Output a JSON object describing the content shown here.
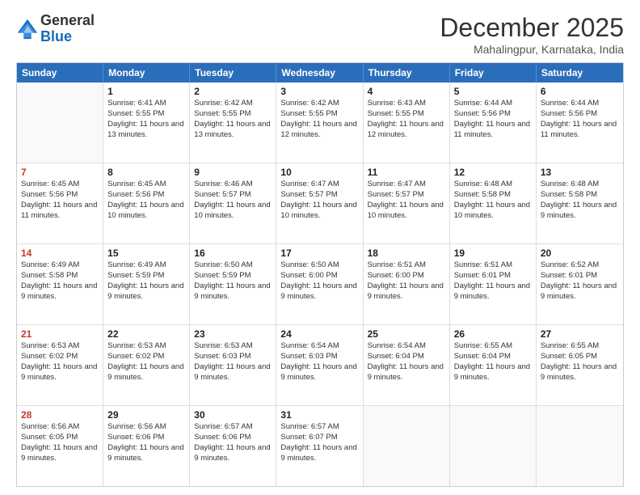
{
  "header": {
    "logo_general": "General",
    "logo_blue": "Blue",
    "month_title": "December 2025",
    "location": "Mahalingpur, Karnataka, India"
  },
  "weekdays": [
    "Sunday",
    "Monday",
    "Tuesday",
    "Wednesday",
    "Thursday",
    "Friday",
    "Saturday"
  ],
  "rows": [
    [
      {
        "day": "",
        "sunrise": "",
        "sunset": "",
        "daylight": "",
        "empty": true
      },
      {
        "day": "1",
        "sunrise": "Sunrise: 6:41 AM",
        "sunset": "Sunset: 5:55 PM",
        "daylight": "Daylight: 11 hours and 13 minutes."
      },
      {
        "day": "2",
        "sunrise": "Sunrise: 6:42 AM",
        "sunset": "Sunset: 5:55 PM",
        "daylight": "Daylight: 11 hours and 13 minutes."
      },
      {
        "day": "3",
        "sunrise": "Sunrise: 6:42 AM",
        "sunset": "Sunset: 5:55 PM",
        "daylight": "Daylight: 11 hours and 12 minutes."
      },
      {
        "day": "4",
        "sunrise": "Sunrise: 6:43 AM",
        "sunset": "Sunset: 5:55 PM",
        "daylight": "Daylight: 11 hours and 12 minutes."
      },
      {
        "day": "5",
        "sunrise": "Sunrise: 6:44 AM",
        "sunset": "Sunset: 5:56 PM",
        "daylight": "Daylight: 11 hours and 11 minutes."
      },
      {
        "day": "6",
        "sunrise": "Sunrise: 6:44 AM",
        "sunset": "Sunset: 5:56 PM",
        "daylight": "Daylight: 11 hours and 11 minutes."
      }
    ],
    [
      {
        "day": "7",
        "sunrise": "Sunrise: 6:45 AM",
        "sunset": "Sunset: 5:56 PM",
        "daylight": "Daylight: 11 hours and 11 minutes."
      },
      {
        "day": "8",
        "sunrise": "Sunrise: 6:45 AM",
        "sunset": "Sunset: 5:56 PM",
        "daylight": "Daylight: 11 hours and 10 minutes."
      },
      {
        "day": "9",
        "sunrise": "Sunrise: 6:46 AM",
        "sunset": "Sunset: 5:57 PM",
        "daylight": "Daylight: 11 hours and 10 minutes."
      },
      {
        "day": "10",
        "sunrise": "Sunrise: 6:47 AM",
        "sunset": "Sunset: 5:57 PM",
        "daylight": "Daylight: 11 hours and 10 minutes."
      },
      {
        "day": "11",
        "sunrise": "Sunrise: 6:47 AM",
        "sunset": "Sunset: 5:57 PM",
        "daylight": "Daylight: 11 hours and 10 minutes."
      },
      {
        "day": "12",
        "sunrise": "Sunrise: 6:48 AM",
        "sunset": "Sunset: 5:58 PM",
        "daylight": "Daylight: 11 hours and 10 minutes."
      },
      {
        "day": "13",
        "sunrise": "Sunrise: 6:48 AM",
        "sunset": "Sunset: 5:58 PM",
        "daylight": "Daylight: 11 hours and 9 minutes."
      }
    ],
    [
      {
        "day": "14",
        "sunrise": "Sunrise: 6:49 AM",
        "sunset": "Sunset: 5:58 PM",
        "daylight": "Daylight: 11 hours and 9 minutes."
      },
      {
        "day": "15",
        "sunrise": "Sunrise: 6:49 AM",
        "sunset": "Sunset: 5:59 PM",
        "daylight": "Daylight: 11 hours and 9 minutes."
      },
      {
        "day": "16",
        "sunrise": "Sunrise: 6:50 AM",
        "sunset": "Sunset: 5:59 PM",
        "daylight": "Daylight: 11 hours and 9 minutes."
      },
      {
        "day": "17",
        "sunrise": "Sunrise: 6:50 AM",
        "sunset": "Sunset: 6:00 PM",
        "daylight": "Daylight: 11 hours and 9 minutes."
      },
      {
        "day": "18",
        "sunrise": "Sunrise: 6:51 AM",
        "sunset": "Sunset: 6:00 PM",
        "daylight": "Daylight: 11 hours and 9 minutes."
      },
      {
        "day": "19",
        "sunrise": "Sunrise: 6:51 AM",
        "sunset": "Sunset: 6:01 PM",
        "daylight": "Daylight: 11 hours and 9 minutes."
      },
      {
        "day": "20",
        "sunrise": "Sunrise: 6:52 AM",
        "sunset": "Sunset: 6:01 PM",
        "daylight": "Daylight: 11 hours and 9 minutes."
      }
    ],
    [
      {
        "day": "21",
        "sunrise": "Sunrise: 6:53 AM",
        "sunset": "Sunset: 6:02 PM",
        "daylight": "Daylight: 11 hours and 9 minutes."
      },
      {
        "day": "22",
        "sunrise": "Sunrise: 6:53 AM",
        "sunset": "Sunset: 6:02 PM",
        "daylight": "Daylight: 11 hours and 9 minutes."
      },
      {
        "day": "23",
        "sunrise": "Sunrise: 6:53 AM",
        "sunset": "Sunset: 6:03 PM",
        "daylight": "Daylight: 11 hours and 9 minutes."
      },
      {
        "day": "24",
        "sunrise": "Sunrise: 6:54 AM",
        "sunset": "Sunset: 6:03 PM",
        "daylight": "Daylight: 11 hours and 9 minutes."
      },
      {
        "day": "25",
        "sunrise": "Sunrise: 6:54 AM",
        "sunset": "Sunset: 6:04 PM",
        "daylight": "Daylight: 11 hours and 9 minutes."
      },
      {
        "day": "26",
        "sunrise": "Sunrise: 6:55 AM",
        "sunset": "Sunset: 6:04 PM",
        "daylight": "Daylight: 11 hours and 9 minutes."
      },
      {
        "day": "27",
        "sunrise": "Sunrise: 6:55 AM",
        "sunset": "Sunset: 6:05 PM",
        "daylight": "Daylight: 11 hours and 9 minutes."
      }
    ],
    [
      {
        "day": "28",
        "sunrise": "Sunrise: 6:56 AM",
        "sunset": "Sunset: 6:05 PM",
        "daylight": "Daylight: 11 hours and 9 minutes."
      },
      {
        "day": "29",
        "sunrise": "Sunrise: 6:56 AM",
        "sunset": "Sunset: 6:06 PM",
        "daylight": "Daylight: 11 hours and 9 minutes."
      },
      {
        "day": "30",
        "sunrise": "Sunrise: 6:57 AM",
        "sunset": "Sunset: 6:06 PM",
        "daylight": "Daylight: 11 hours and 9 minutes."
      },
      {
        "day": "31",
        "sunrise": "Sunrise: 6:57 AM",
        "sunset": "Sunset: 6:07 PM",
        "daylight": "Daylight: 11 hours and 9 minutes."
      },
      {
        "day": "",
        "sunrise": "",
        "sunset": "",
        "daylight": "",
        "empty": true
      },
      {
        "day": "",
        "sunrise": "",
        "sunset": "",
        "daylight": "",
        "empty": true
      },
      {
        "day": "",
        "sunrise": "",
        "sunset": "",
        "daylight": "",
        "empty": true
      }
    ]
  ]
}
